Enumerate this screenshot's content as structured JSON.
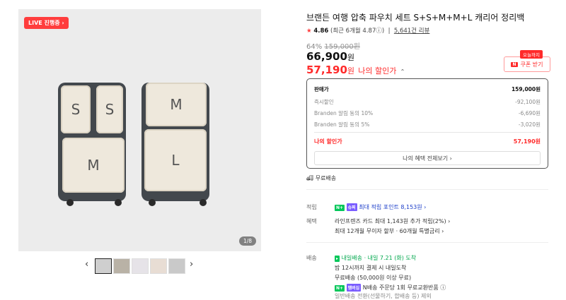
{
  "gallery": {
    "live_badge": "LIVE 진행중 ›",
    "counter": "1/8",
    "pouch_labels": [
      "S",
      "S",
      "M",
      "M",
      "L"
    ],
    "prev_icon": "‹",
    "next_icon": "›"
  },
  "product": {
    "title": "브랜든 여행 압축 파우치 세트 S+S+M+M+L 캐리어 정리백",
    "rating_star": "★",
    "rating": "4.86",
    "rating_recent": "(최근 6개월 4.87ⓘ)",
    "reviews": "5,641건 리뷰",
    "discount_rate": "64%",
    "original_price": "159,000원",
    "sale_price": "66,900",
    "won": "원",
    "my_price": "57,190",
    "my_price_label": "나의 할인가",
    "today_badge": "오늘까지",
    "coupon_label": "쿠폰 받기",
    "coupon_mark": "N"
  },
  "price_box": {
    "rows": [
      {
        "label": "판매가",
        "value": "159,000원"
      },
      {
        "label": "즉시할인",
        "value": "-92,100원"
      },
      {
        "label": "Branden 알림 동의 10%",
        "value": "-6,690원"
      },
      {
        "label": "Branden 알림 동의 5%",
        "value": "-3,020원"
      }
    ],
    "my_label": "나의 할인가",
    "my_value": "57,190원",
    "benefits_button": "나의 혜택 전체보기 ›"
  },
  "shipping": {
    "free": "무료배송",
    "points_label": "적립",
    "points_text": "최대 적립 포인트 8,153원 ›",
    "benefit_label": "혜택",
    "benefit_line1": "라인프렌즈 카드 최대 1,143원 추가 적립(2%) ›",
    "benefit_line2": "최대 12개월 무이자 할부 · 60개월 특별금리 ›",
    "delivery_label": "배송",
    "delivery_type": "내일배송",
    "delivery_date": "· 내일 7.21 (화) 도착",
    "delivery_line2": "밤 12시까지 결제 시 내일도착",
    "delivery_line3": "무료배송 (50,000원 이상 무료)",
    "delivery_line4": "N배송 주문당 1회 무료교환반품 ⓘ",
    "delivery_line5": "일반배송 전환(선물하기, 합배송 등) 제외",
    "badge_n": "N+",
    "badge_member": "멤버십",
    "badge_sale": "슈퍼"
  },
  "colors": {
    "accent": "#ff2a2a",
    "green": "#03c75a"
  }
}
